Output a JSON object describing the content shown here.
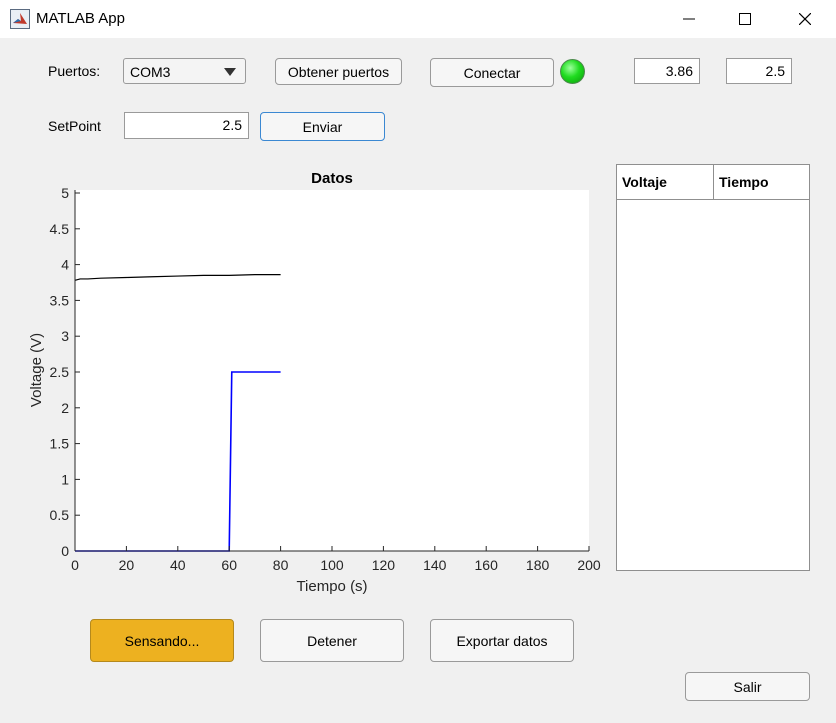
{
  "window": {
    "title": "MATLAB App"
  },
  "controls": {
    "ports_label": "Puertos:",
    "ports_selected": "COM3",
    "get_ports_label": "Obtener puertos",
    "connect_label": "Conectar",
    "status_lamp_color": "#1fdc1f",
    "readout_voltage": "3.86",
    "readout_setpoint": "2.5",
    "setpoint_label": "SetPoint",
    "setpoint_value": "2.5",
    "send_label": "Enviar"
  },
  "table": {
    "col_voltaje": "Voltaje",
    "col_tiempo": "Tiempo"
  },
  "buttons": {
    "sensing_label": "Sensando...",
    "stop_label": "Detener",
    "export_label": "Exportar datos",
    "exit_label": "Salir"
  },
  "chart_data": {
    "type": "line",
    "title": "Datos",
    "xlabel": "Tiempo (s)",
    "ylabel": "Voltage (V)",
    "xlim": [
      0,
      200
    ],
    "ylim": [
      0,
      5
    ],
    "xticks": [
      0,
      20,
      40,
      60,
      80,
      100,
      120,
      140,
      160,
      180,
      200
    ],
    "yticks": [
      0,
      0.5,
      1,
      1.5,
      2,
      2.5,
      3,
      3.5,
      4,
      4.5,
      5
    ],
    "grid": false,
    "series": [
      {
        "color": "#000000",
        "x": [
          0,
          2,
          5,
          10,
          20,
          30,
          40,
          50,
          60,
          70,
          80
        ],
        "y": [
          3.78,
          3.8,
          3.8,
          3.81,
          3.82,
          3.83,
          3.84,
          3.85,
          3.85,
          3.86,
          3.86
        ]
      },
      {
        "color": "#0000ff",
        "x": [
          0,
          60,
          61,
          80
        ],
        "y": [
          0,
          0,
          2.5,
          2.5
        ]
      }
    ]
  }
}
